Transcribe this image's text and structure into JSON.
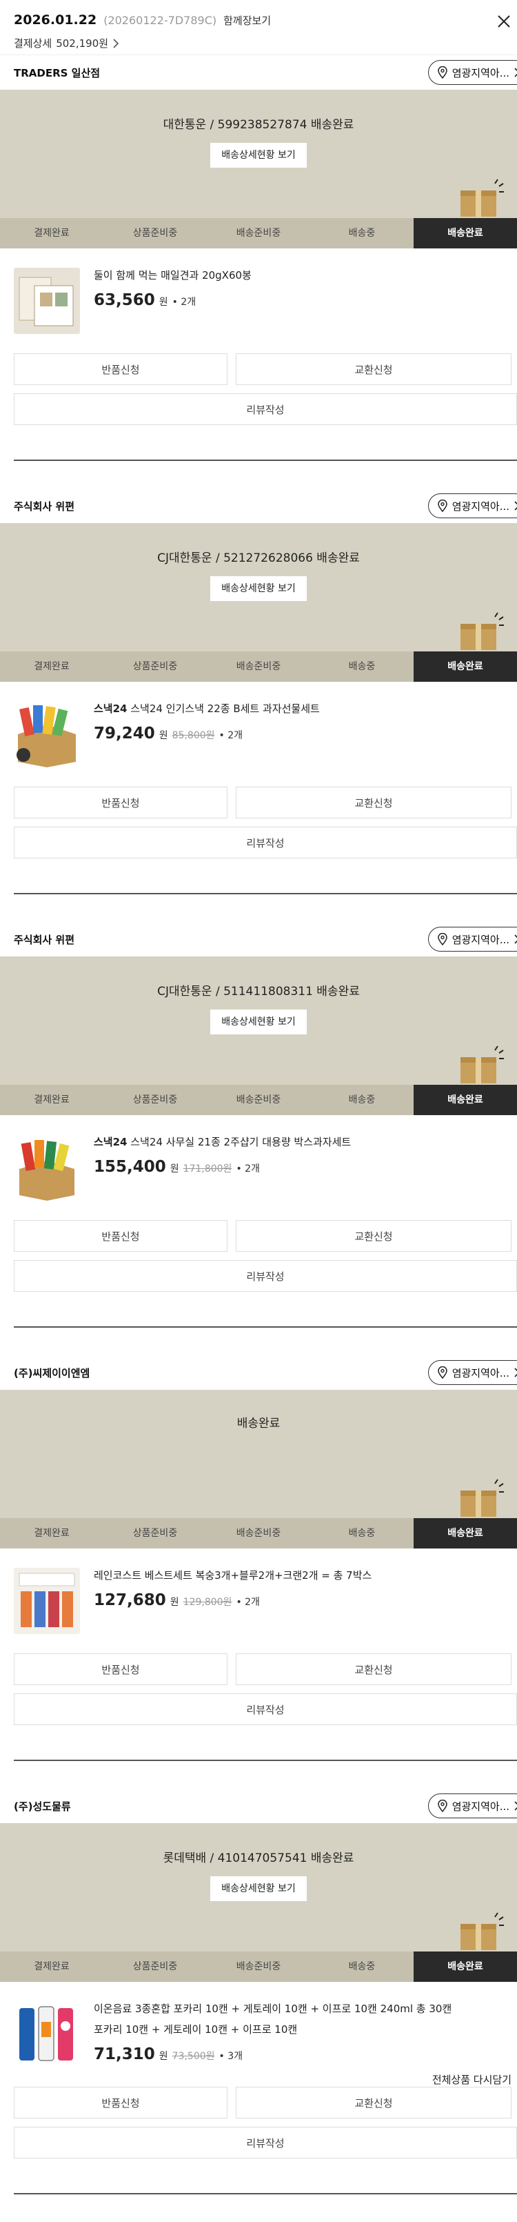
{
  "header": {
    "order_date": "2026.01.22",
    "order_no": "(20260122-7D789C)",
    "order_tag": "함께장보기",
    "pay_label": "결제상세",
    "pay_amount": "502,190원"
  },
  "common": {
    "region_label": "염광지역아...",
    "detail_button": "배송상세현황 보기",
    "return_button": "반품신청",
    "exchange_button": "교환신청",
    "review_button": "리뷰작성",
    "won": "원"
  },
  "steps": [
    "결제완료",
    "상품준비중",
    "배송준비중",
    "배송중",
    "배송완료"
  ],
  "groups": [
    {
      "seller": "TRADERS 일산점",
      "carrier_text": "대한통운 / 599238527874 배송완료",
      "show_detail": true,
      "product": {
        "brand": "",
        "name": "둘이 함께 먹는 매일견과 20gX60봉",
        "line2": "",
        "price": "63,560",
        "orig": "",
        "qty": "• 2개"
      }
    },
    {
      "seller": "주식회사 위편",
      "carrier_text": "CJ대한통운 / 521272628066 배송완료",
      "show_detail": true,
      "product": {
        "brand": "스낵24",
        "name": " 스낵24 인기스낵 22종 B세트 과자선물세트",
        "line2": "",
        "price": "79,240",
        "orig": "85,800원",
        "qty": "• 2개"
      }
    },
    {
      "seller": "주식회사 위편",
      "carrier_text": "CJ대한통운 / 511411808311 배송완료",
      "show_detail": true,
      "product": {
        "brand": "스낵24",
        "name": " 스낵24 사무실 21종 2주샵기 대용량 박스과자세트",
        "line2": "",
        "price": "155,400",
        "orig": "171,800원",
        "qty": "• 2개"
      }
    },
    {
      "seller": "(주)씨제이이엔엠",
      "carrier_text": "배송완료",
      "show_detail": false,
      "product": {
        "brand": "",
        "name": "레인코스트 베스트세트 복숭3개+블루2개+크랜2개 = 총 7박스",
        "line2": "",
        "price": "127,680",
        "orig": "129,800원",
        "qty": "• 2개"
      }
    },
    {
      "seller": "(주)성도물류",
      "carrier_text": "롯데택배 / 410147057541 배송완료",
      "show_detail": true,
      "product": {
        "brand": "",
        "name": "이온음료 3종혼합 포카리 10캔 + 게토레이 10캔 + 이프로 10캔 240ml 총 30캔",
        "line2": "포카리 10캔 + 게토레이 10캔 + 이프로 10캔",
        "price": "71,310",
        "orig": "73,500원",
        "qty": "• 3개"
      }
    }
  ],
  "footer": {
    "repurchase_all": "전체상품 다시담기"
  }
}
